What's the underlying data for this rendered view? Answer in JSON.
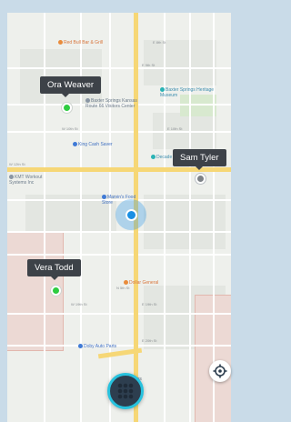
{
  "markers": [
    {
      "name": "Ora Weaver",
      "status": "online"
    },
    {
      "name": "Sam Tyler",
      "status": "offline"
    },
    {
      "name": "Vera Todd",
      "status": "online"
    }
  ],
  "map": {
    "streets": {
      "e12th": "E 12th St",
      "w12th": "W 12th St",
      "e19th": "E 19th St",
      "w19th": "W 19th St",
      "e9th": "E 9th St",
      "e10th": "E 10th St",
      "w10th": "W 10th St",
      "e8th": "E 8th St",
      "e20th": "E 20th St",
      "n5th": "N 5th St"
    },
    "pois": {
      "restaurant": "Red Bull Bar & Grill",
      "museum": "Baxter Springs Heritage Museum",
      "visitors": "Baxter Springs Kansas Route 66 Visitors Center",
      "king_cash": "King Cash Saver",
      "decade": "Decade of Hope",
      "kmt": "KMT Workout Systems Inc",
      "marvin": "Marvin's Food Store",
      "dollar": "Dollar General",
      "auto": "Doby Auto Parts",
      "bell": "Bell Farms"
    }
  },
  "controls": {
    "locate_icon": "crosshair-icon",
    "menu_icon": "grid-menu-icon"
  },
  "colors": {
    "online": "#2ecc40",
    "offline": "#7c8186",
    "accent": "#27c2de",
    "self_location": "#1a8fe3"
  }
}
